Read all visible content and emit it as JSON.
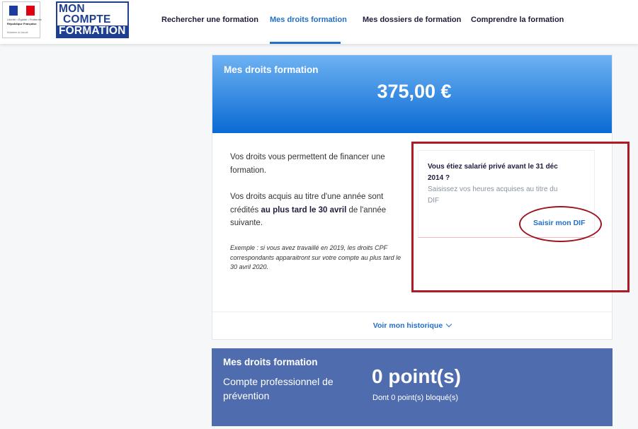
{
  "header": {
    "gov_logo": {
      "line1": "Liberté • Égalité • Fraternité",
      "line2": "République Française",
      "line3": "Ministère du travail"
    },
    "logo": {
      "line1": "MON",
      "line2": "COMPTE",
      "line3": "FORMATION"
    },
    "nav": [
      {
        "label": "Rechercher une formation"
      },
      {
        "label": "Mes droits formation",
        "active": true
      },
      {
        "label": "Mes dossiers de formation"
      },
      {
        "label": "Comprendre la formation"
      }
    ]
  },
  "rights_card": {
    "title": "Mes droits formation",
    "amount": "375,00 €",
    "para1": "Vos droits vous permettent de financer une formation.",
    "para2_before": "Vos droits acquis au titre d'une année sont crédités ",
    "para2_bold": "au plus tard le 30 avril",
    "para2_after": " de l'année suivante.",
    "example": "Exemple : si vous avez travaillé en 2019, les droits CPF correspondants apparaitront sur votre compte au plus tard le 30 avril 2020.",
    "dif_question": "Vous étiez salarié privé avant le 31 déc 2014 ?",
    "dif_hint": "Saisissez vos heures acquises au titre du DIF",
    "dif_button": "Saisir mon DIF",
    "history_link": "Voir mon historique"
  },
  "prevention_card": {
    "title": "Mes droits formation",
    "subtitle": "Compte professionnel de prévention",
    "points": "0 point(s)",
    "blocked": "Dont 0 point(s) bloqué(s)"
  },
  "colors": {
    "accent": "#2170c9",
    "banner_top": "#6eb2f2",
    "banner_bottom": "#0a6ad4",
    "prevention_bg": "#4f6dae",
    "annotation_red": "#b01a25"
  }
}
